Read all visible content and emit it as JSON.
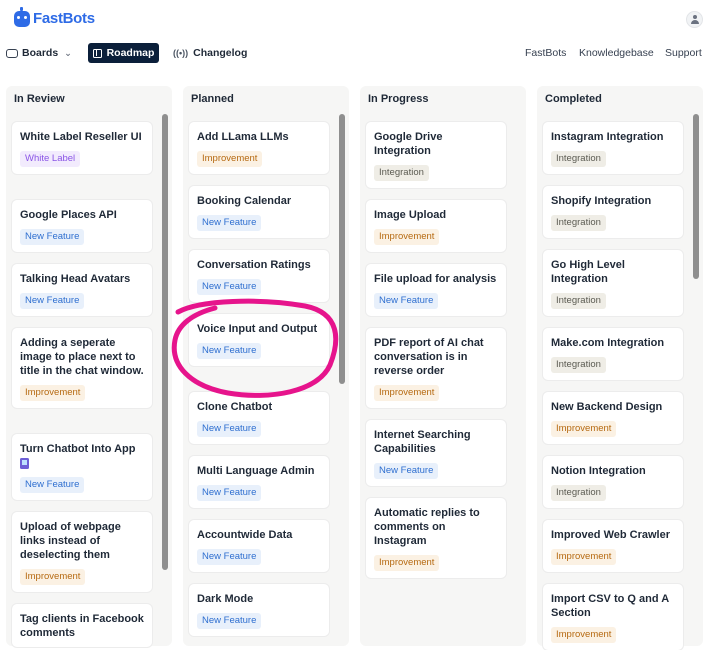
{
  "brand": {
    "name": "FastBots"
  },
  "nav": {
    "boards": "Boards",
    "roadmap": "Roadmap",
    "changelog": "Changelog",
    "right": [
      "FastBots",
      "Knowledgebase",
      "Support"
    ]
  },
  "columns": [
    {
      "title": "In Review",
      "cards": [
        {
          "title": "White Label Reseller UI",
          "tag": "White Label"
        },
        {
          "title": "Google Places API",
          "tag": "New Feature"
        },
        {
          "title": "Talking Head Avatars",
          "tag": "New Feature"
        },
        {
          "title": "Adding a seperate image to place next to title in the chat window.",
          "tag": "Improvement"
        },
        {
          "title": "Turn Chatbot Into App",
          "tag": "New Feature"
        },
        {
          "title": "Upload of webpage links instead of deselecting them",
          "tag": "Improvement"
        },
        {
          "title": "Tag clients in Facebook comments"
        }
      ]
    },
    {
      "title": "Planned",
      "cards": [
        {
          "title": "Add LLama LLMs",
          "tag": "Improvement"
        },
        {
          "title": "Booking Calendar",
          "tag": "New Feature"
        },
        {
          "title": "Conversation Ratings",
          "tag": "New Feature"
        },
        {
          "title": "Voice Input and Output",
          "tag": "New Feature"
        },
        {
          "title": "Clone Chatbot",
          "tag": "New Feature"
        },
        {
          "title": "Multi Language Admin",
          "tag": "New Feature"
        },
        {
          "title": "Accountwide Data",
          "tag": "New Feature"
        },
        {
          "title": "Dark Mode",
          "tag": "New Feature"
        }
      ]
    },
    {
      "title": "In Progress",
      "cards": [
        {
          "title": "Google Drive Integration",
          "tag": "Integration"
        },
        {
          "title": "Image Upload",
          "tag": "Improvement"
        },
        {
          "title": "File upload for analysis",
          "tag": "New Feature"
        },
        {
          "title": "PDF report of AI chat conversation is in reverse order",
          "tag": "Improvement"
        },
        {
          "title": "Internet Searching Capabilities",
          "tag": "New Feature"
        },
        {
          "title": "Automatic replies to comments on Instagram",
          "tag": "Improvement"
        }
      ]
    },
    {
      "title": "Completed",
      "cards": [
        {
          "title": "Instagram Integration",
          "tag": "Integration"
        },
        {
          "title": "Shopify Integration",
          "tag": "Integration"
        },
        {
          "title": "Go High Level Integration",
          "tag": "Integration"
        },
        {
          "title": "Make.com Integration",
          "tag": "Integration"
        },
        {
          "title": "New Backend Design",
          "tag": "Improvement"
        },
        {
          "title": "Notion Integration",
          "tag": "Integration"
        },
        {
          "title": "Improved Web Crawler",
          "tag": "Improvement"
        },
        {
          "title": "Import CSV to Q and A Section",
          "tag": "Improvement"
        }
      ]
    }
  ],
  "colors": {
    "brand": "#2e6be6",
    "nav_active": "#0b1f3a",
    "annotation": "#e6148c",
    "tag_new_feature": "#2f6fd0",
    "tag_improvement": "#b66a12",
    "tag_integration": "#5b5b52",
    "tag_white_label": "#8b55e6"
  },
  "icons": {
    "boards": "board-icon",
    "roadmap": "roadmap-icon",
    "changelog": "broadcast-icon",
    "app_emoji": "mobile-phone-icon"
  }
}
